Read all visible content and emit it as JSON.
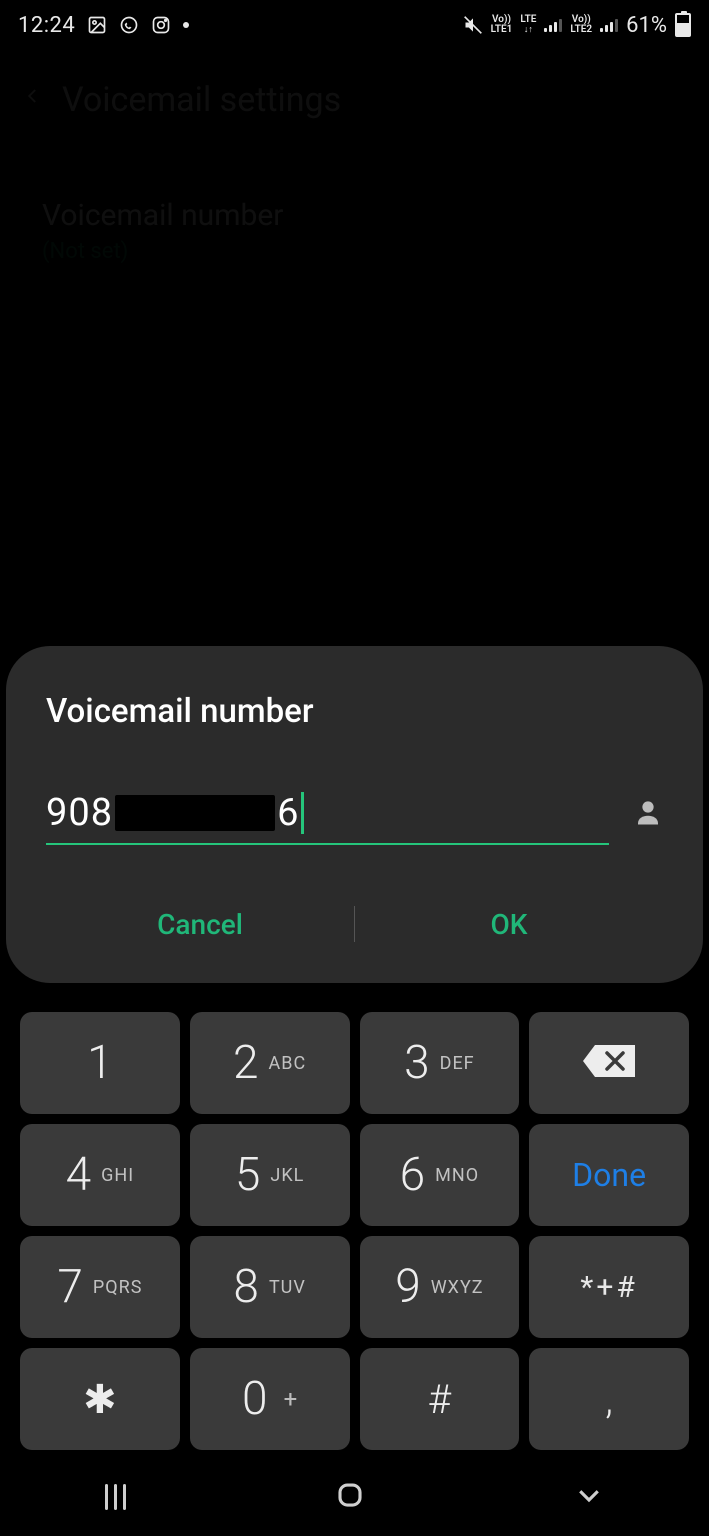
{
  "status": {
    "time": "12:24",
    "battery_text": "61%",
    "lte1": "LTE1",
    "lte2": "LTE2",
    "lte_label": "LTE",
    "vo_label": "Vo))"
  },
  "header": {
    "title": "Voicemail settings"
  },
  "setting": {
    "title": "Voicemail number",
    "subtitle": "(Not set)"
  },
  "dialog": {
    "title": "Voicemail number",
    "number_prefix": "908",
    "number_suffix": "6",
    "cancel_label": "Cancel",
    "ok_label": "OK"
  },
  "keypad": {
    "k1": "1",
    "k1_letters": "",
    "k2": "2",
    "k2_letters": "ABC",
    "k3": "3",
    "k3_letters": "DEF",
    "k4": "4",
    "k4_letters": "GHI",
    "k5": "5",
    "k5_letters": "JKL",
    "k6": "6",
    "k6_letters": "MNO",
    "k7": "7",
    "k7_letters": "PQRS",
    "k8": "8",
    "k8_letters": "TUV",
    "k9": "9",
    "k9_letters": "WXYZ",
    "k0": "0",
    "k0_sub": "+",
    "star": "✱",
    "hash": "#",
    "comma": ",",
    "symbols": "*+#",
    "done": "Done"
  }
}
